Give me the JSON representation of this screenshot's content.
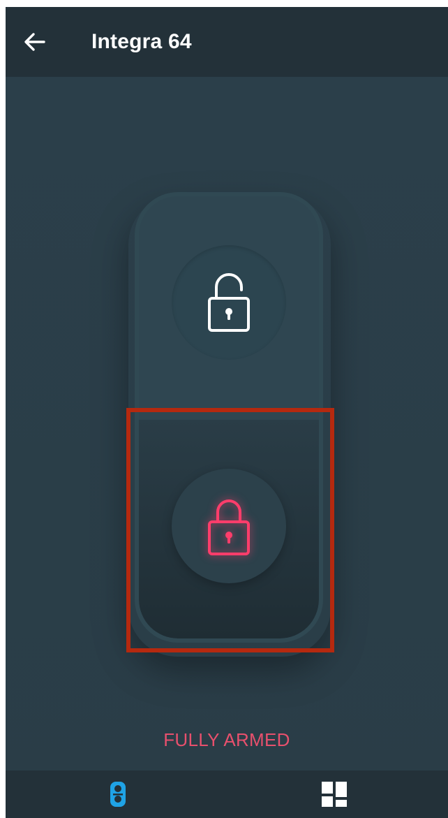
{
  "header": {
    "title": "Integra 64",
    "back_icon": "arrow-left-icon"
  },
  "arming_switch": {
    "upper_state_icon": "lock-open-icon",
    "lower_state_icon": "lock-closed-icon",
    "active_state": "lower"
  },
  "status": {
    "text": "FULLY ARMED"
  },
  "bottom_nav": {
    "items": [
      {
        "icon": "switch-icon",
        "active": true
      },
      {
        "icon": "dashboard-grid-icon",
        "active": false
      }
    ]
  },
  "colors": {
    "background": "#2b3e48",
    "appbar": "#233139",
    "armed_accent": "#ff3d6b",
    "status_text": "#e8506d",
    "nav_active": "#1fa3e6",
    "highlight_box": "#b5290f"
  }
}
